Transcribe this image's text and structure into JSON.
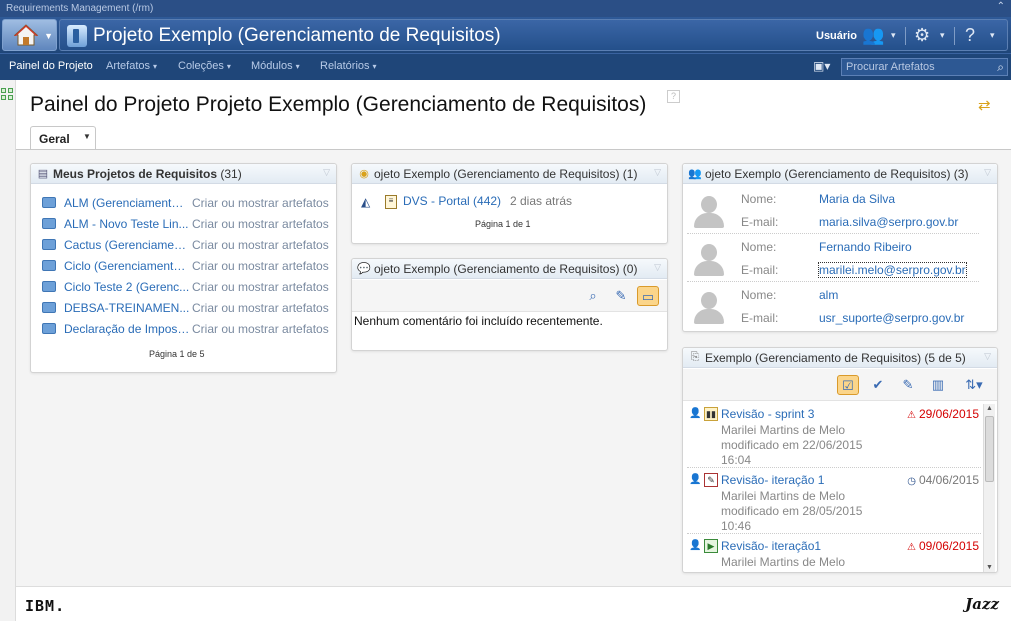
{
  "app": {
    "strip_title": "Requirements Management (/rm)",
    "project_title": "Projeto Exemplo (Gerenciamento de Requisitos)",
    "user_label": "Usuário"
  },
  "nav": {
    "items": [
      {
        "label": "Painel do Projeto"
      },
      {
        "label": "Artefatos"
      },
      {
        "label": "Coleções"
      },
      {
        "label": "Módulos"
      },
      {
        "label": "Relatórios"
      }
    ],
    "search_placeholder": "Procurar Artefatos"
  },
  "page": {
    "title": "Painel do Projeto Projeto Exemplo (Gerenciamento de Requisitos)",
    "tab": "Geral"
  },
  "my_projects": {
    "title": "Meus Projetos de Requisitos",
    "count": "(31)",
    "rows": [
      {
        "name": "ALM (Gerenciamento ...",
        "action": "Criar ou mostrar artefatos"
      },
      {
        "name": "ALM - Novo Teste Lin...",
        "action": "Criar ou mostrar artefatos"
      },
      {
        "name": "Cactus (Gerenciamen...",
        "action": "Criar ou mostrar artefatos"
      },
      {
        "name": "Ciclo (Gerenciamento...",
        "action": "Criar ou mostrar artefatos"
      },
      {
        "name": "Ciclo Teste 2 (Gerenc...",
        "action": "Criar ou mostrar artefatos"
      },
      {
        "name": "DEBSA-TREINAMEN...",
        "action": "Criar ou mostrar artefatos"
      },
      {
        "name": "Declaração de Impost...",
        "action": "Criar ou mostrar artefatos"
      }
    ],
    "pager": "Página 1 de 5"
  },
  "artifacts_widget": {
    "title": "ojeto Exemplo (Gerenciamento de Requisitos) (1)",
    "item_name": "DVS - Portal (442)",
    "item_time": "2 dias atrás",
    "pager": "Página 1 de 1"
  },
  "comments_widget": {
    "title": "ojeto Exemplo (Gerenciamento de Requisitos) (0)",
    "empty_text": "Nenhum comentário foi incluído recentemente."
  },
  "members_widget": {
    "title": "ojeto Exemplo (Gerenciamento de Requisitos) (3)",
    "name_label": "Nome:",
    "email_label": "E-mail:",
    "members": [
      {
        "name": "Maria da Silva",
        "email": "maria.silva@serpro.gov.br"
      },
      {
        "name": "Fernando Ribeiro",
        "email": "marilei.melo@serpro.gov.br"
      },
      {
        "name": "alm",
        "email": "usr_suporte@serpro.gov.br"
      }
    ]
  },
  "reviews_widget": {
    "title": "Exemplo (Gerenciamento de Requisitos) (5 de 5)",
    "reviews": [
      {
        "title": "Revisão - sprint 3",
        "author": "Marilei Martins de Melo",
        "modified": "modificado em 22/06/2015",
        "time": "16:04",
        "date": "29/06/2015",
        "status": "overdue"
      },
      {
        "title": "Revisão- iteração 1",
        "author": "Marilei Martins de Melo",
        "modified": "modificado em 28/05/2015",
        "time": "10:46",
        "date": "04/06/2015",
        "status": "normal"
      },
      {
        "title": "Revisão- iteração1",
        "author": "Marilei Martins de Melo",
        "modified": "",
        "time": "",
        "date": "09/06/2015",
        "status": "overdue"
      }
    ]
  },
  "footer": {
    "ibm": "IBM.",
    "jazz": "Jazz"
  },
  "colors": {
    "header_blue": "#2b4f86",
    "link_blue": "#2a6cb7",
    "overdue_red": "#d40000"
  }
}
